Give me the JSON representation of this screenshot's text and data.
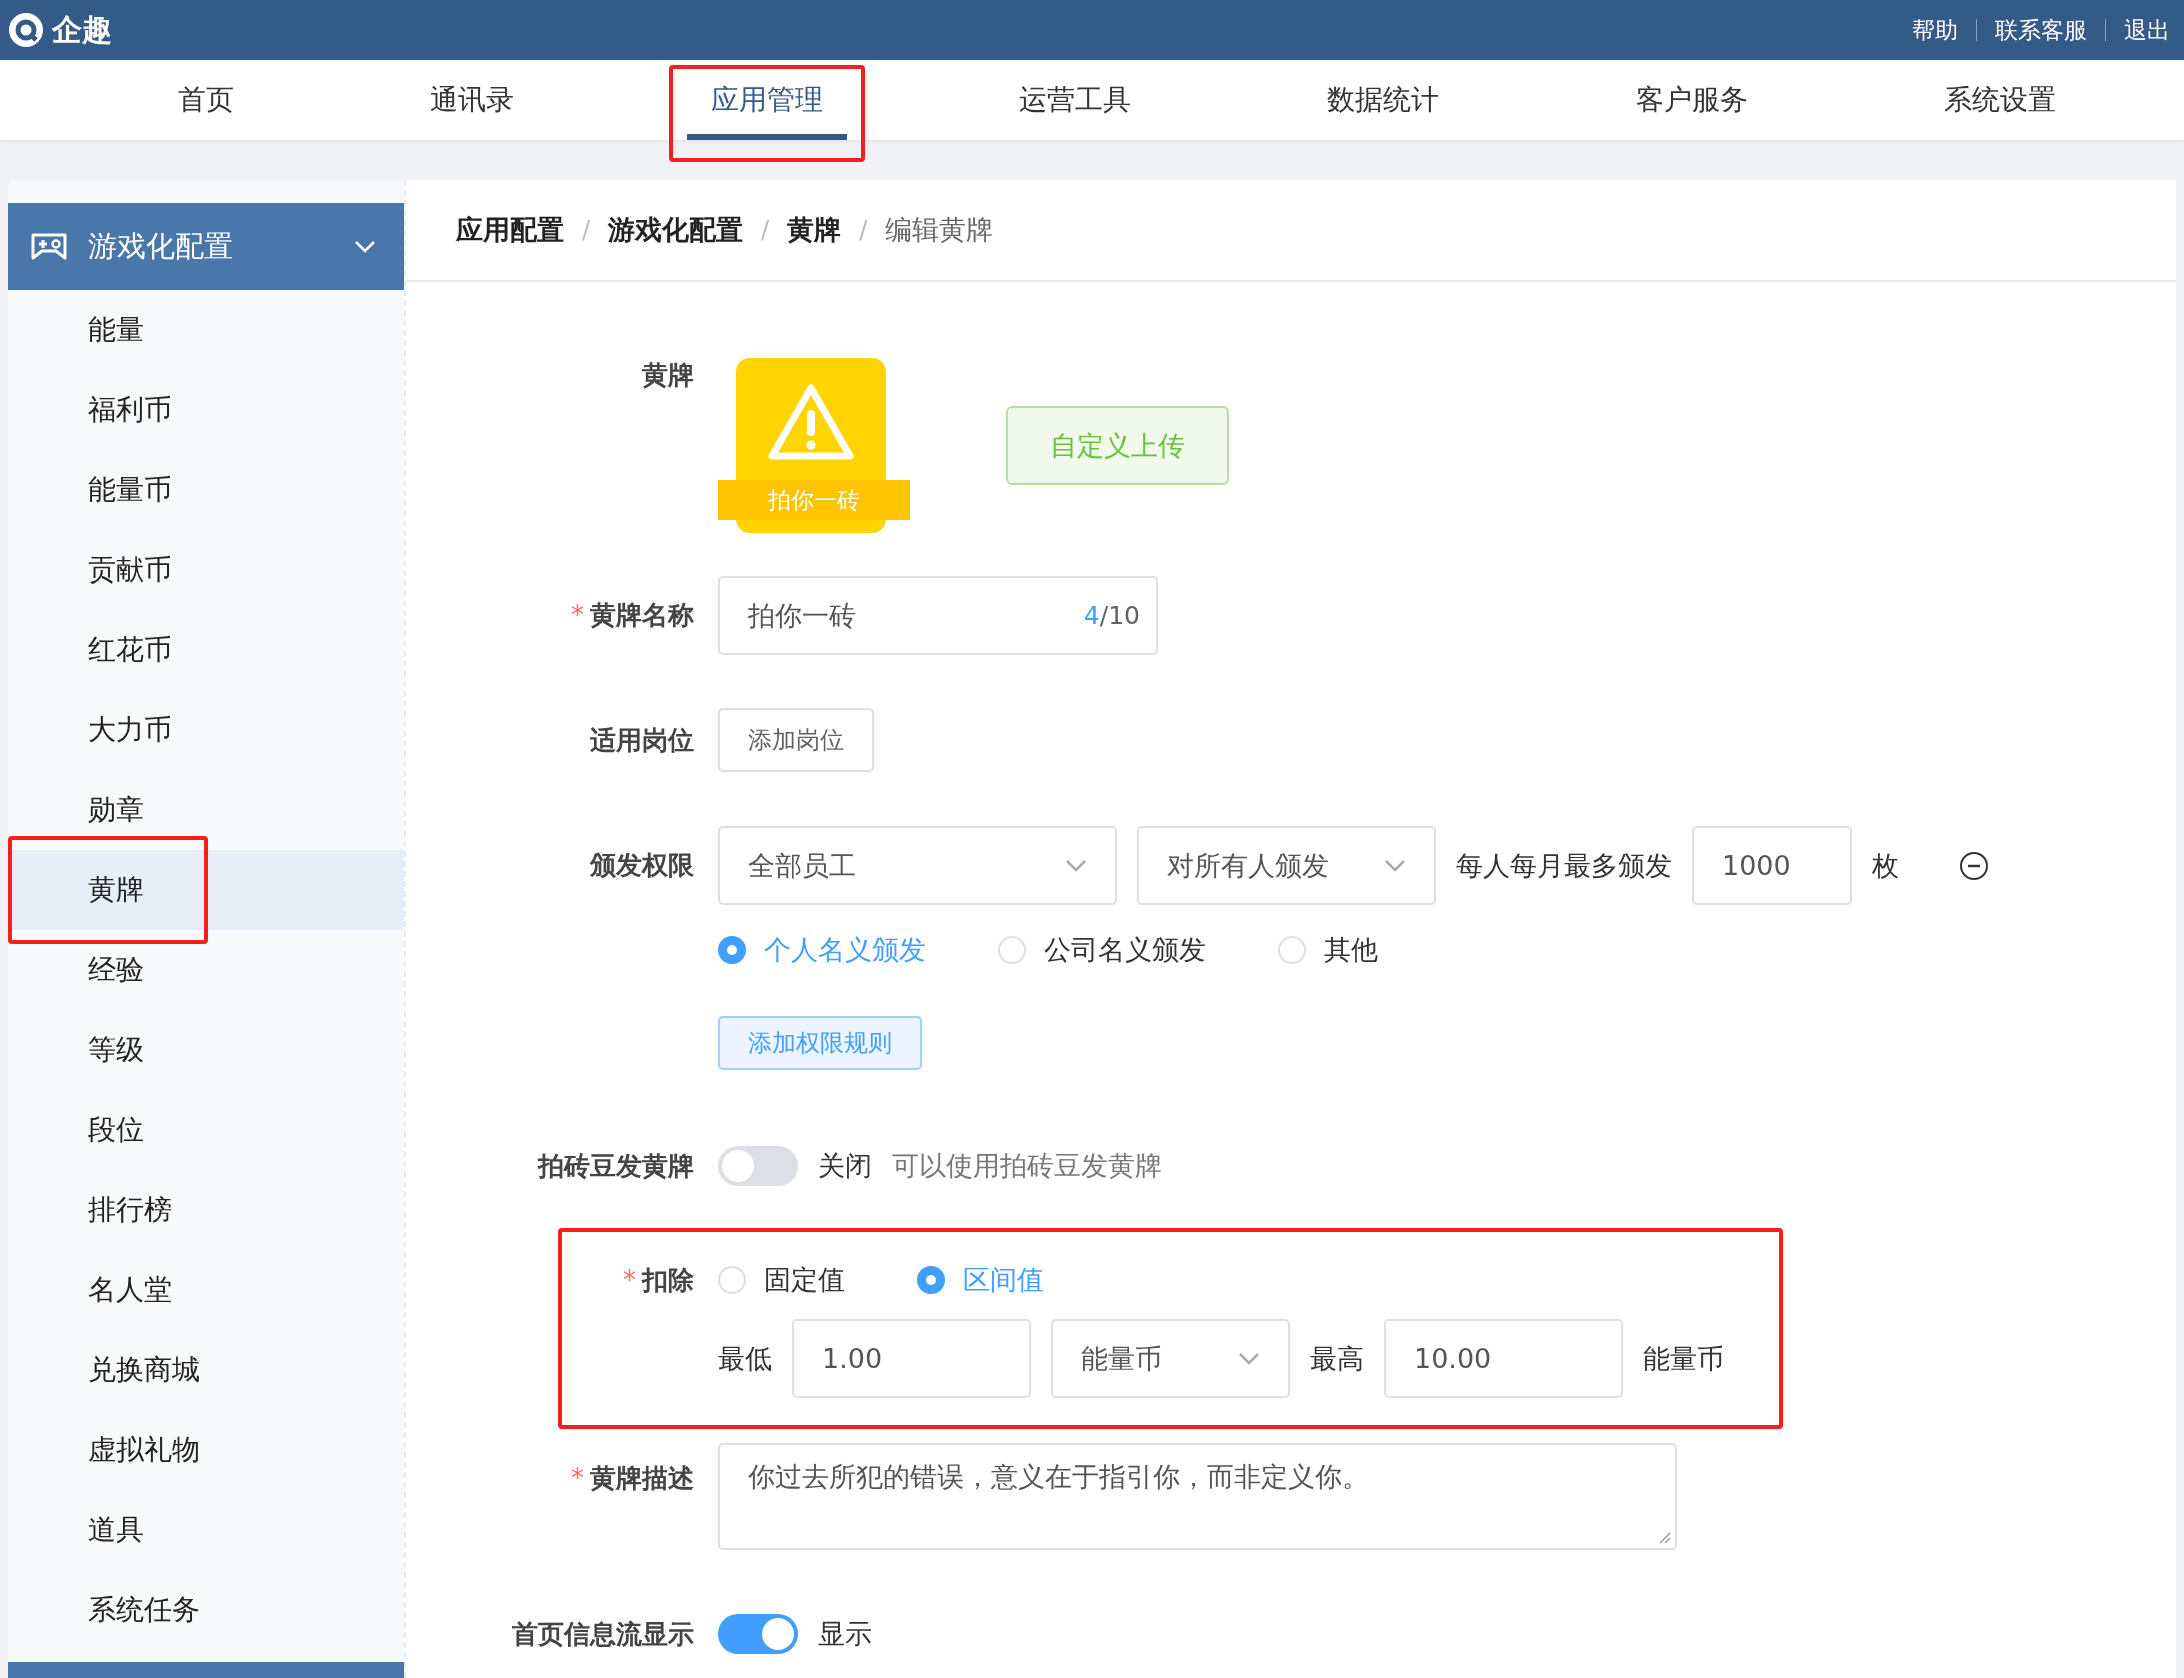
{
  "app": {
    "name": "企趣"
  },
  "header_links": [
    {
      "label": "帮助"
    },
    {
      "label": "联系客服"
    },
    {
      "label": "退出"
    }
  ],
  "nav": [
    {
      "label": "首页",
      "selected": false,
      "highlighted": false
    },
    {
      "label": "通讯录",
      "selected": false,
      "highlighted": false
    },
    {
      "label": "应用管理",
      "selected": true,
      "highlighted": true
    },
    {
      "label": "运营工具",
      "selected": false,
      "highlighted": false
    },
    {
      "label": "数据统计",
      "selected": false,
      "highlighted": false
    },
    {
      "label": "客户服务",
      "selected": false,
      "highlighted": false
    },
    {
      "label": "系统设置",
      "selected": false,
      "highlighted": false
    }
  ],
  "sidebar": {
    "group": {
      "label": "游戏化配置",
      "expanded": true
    },
    "items": [
      {
        "label": "能量",
        "selected": false,
        "highlighted": false
      },
      {
        "label": "福利币",
        "selected": false,
        "highlighted": false
      },
      {
        "label": "能量币",
        "selected": false,
        "highlighted": false
      },
      {
        "label": "贡献币",
        "selected": false,
        "highlighted": false
      },
      {
        "label": "红花币",
        "selected": false,
        "highlighted": false
      },
      {
        "label": "大力币",
        "selected": false,
        "highlighted": false
      },
      {
        "label": "勋章",
        "selected": false,
        "highlighted": false
      },
      {
        "label": "黄牌",
        "selected": true,
        "highlighted": true
      },
      {
        "label": "经验",
        "selected": false,
        "highlighted": false
      },
      {
        "label": "等级",
        "selected": false,
        "highlighted": false
      },
      {
        "label": "段位",
        "selected": false,
        "highlighted": false
      },
      {
        "label": "排行榜",
        "selected": false,
        "highlighted": false
      },
      {
        "label": "名人堂",
        "selected": false,
        "highlighted": false
      },
      {
        "label": "兑换商城",
        "selected": false,
        "highlighted": false
      },
      {
        "label": "虚拟礼物",
        "selected": false,
        "highlighted": false
      },
      {
        "label": "道具",
        "selected": false,
        "highlighted": false
      },
      {
        "label": "系统任务",
        "selected": false,
        "highlighted": false
      }
    ]
  },
  "breadcrumb": {
    "separator": "/",
    "items": [
      {
        "label": "应用配置",
        "current": false
      },
      {
        "label": "游戏化配置",
        "current": false
      },
      {
        "label": "黄牌",
        "current": false
      },
      {
        "label": "编辑黄牌",
        "current": true
      }
    ]
  },
  "form": {
    "badge": {
      "label": "黄牌",
      "caption": "拍你一砖",
      "upload_button": "自定义上传"
    },
    "name": {
      "label": "黄牌名称",
      "required_mark": "*",
      "value": "拍你一砖",
      "count": "4",
      "limit": "/10"
    },
    "positions": {
      "label": "适用岗位",
      "button": "添加岗位"
    },
    "permission": {
      "label": "颁发权限",
      "scope": "全部员工",
      "target": "对所有人颁发",
      "limit_label": "每人每月最多颁发",
      "limit_value": "1000",
      "unit": "枚",
      "modes": [
        {
          "label": "个人名义颁发",
          "selected": true
        },
        {
          "label": "公司名义颁发",
          "selected": false
        },
        {
          "label": "其他",
          "selected": false
        }
      ],
      "add_rule": "添加权限规则"
    },
    "brick": {
      "label": "拍砖豆发黄牌",
      "on": false,
      "state_text": "关闭",
      "hint": "可以使用拍砖豆发黄牌"
    },
    "deduction": {
      "label": "扣除",
      "required_mark": "*",
      "highlighted": true,
      "modes": [
        {
          "label": "固定值",
          "selected": false
        },
        {
          "label": "区间值",
          "selected": true
        }
      ],
      "min_label": "最低",
      "min_value": "1.00",
      "currency": "能量币",
      "max_label": "最高",
      "max_value": "10.00",
      "unit": "能量币"
    },
    "description": {
      "label": "黄牌描述",
      "required_mark": "*",
      "value": "你过去所犯的错误，意义在于指引你，而非定义你。"
    },
    "feed": {
      "label": "首页信息流显示",
      "on": true,
      "state_text": "显示"
    }
  }
}
